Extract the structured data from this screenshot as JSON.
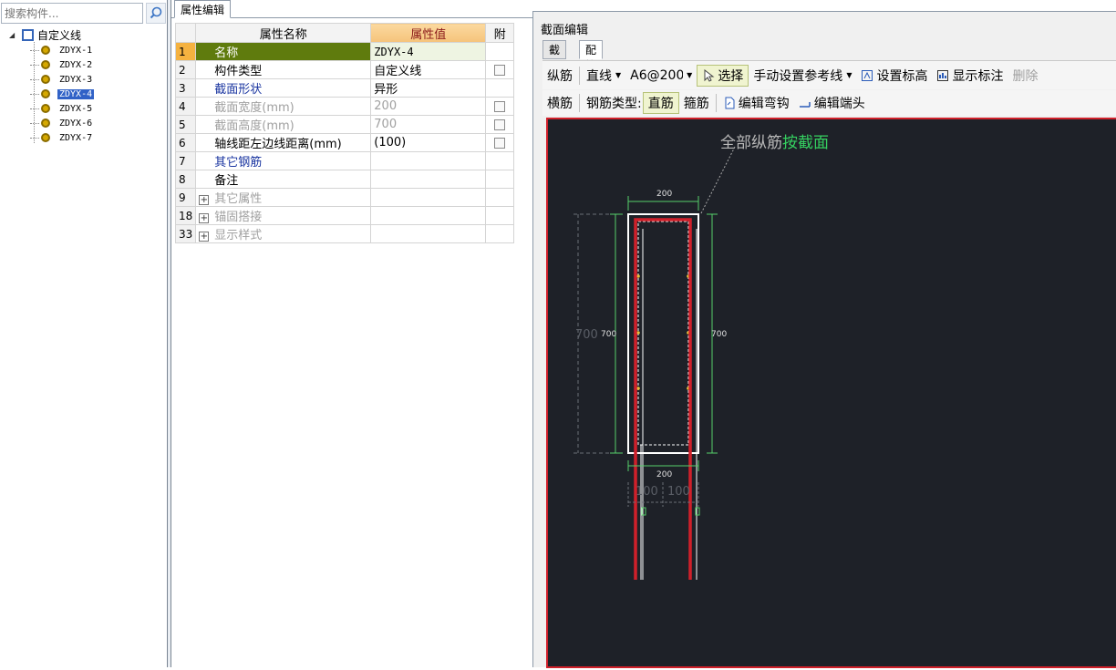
{
  "search": {
    "placeholder": "搜索构件..."
  },
  "tree": {
    "root_label": "自定义线",
    "items": [
      {
        "label": "ZDYX-1",
        "selected": false
      },
      {
        "label": "ZDYX-2",
        "selected": false
      },
      {
        "label": "ZDYX-3",
        "selected": false
      },
      {
        "label": "ZDYX-4",
        "selected": true
      },
      {
        "label": "ZDYX-5",
        "selected": false
      },
      {
        "label": "ZDYX-6",
        "selected": false
      },
      {
        "label": "ZDYX-7",
        "selected": false
      }
    ]
  },
  "property_panel": {
    "tab": "属性编辑",
    "headers": {
      "name": "属性名称",
      "value": "属性值",
      "attach": "附"
    },
    "rows": [
      {
        "num": "1",
        "name": "名称",
        "value": "ZDYX-4"
      },
      {
        "num": "2",
        "name": "构件类型",
        "value": "自定义线"
      },
      {
        "num": "3",
        "name": "截面形状",
        "value": "异形"
      },
      {
        "num": "4",
        "name": "截面宽度(mm)",
        "value": "200"
      },
      {
        "num": "5",
        "name": "截面高度(mm)",
        "value": "700"
      },
      {
        "num": "6",
        "name": "轴线距左边线距离(mm)",
        "value": "(100)"
      },
      {
        "num": "7",
        "name": "其它钢筋",
        "value": ""
      },
      {
        "num": "8",
        "name": "备注",
        "value": ""
      },
      {
        "num": "9",
        "name": "其它属性",
        "value": ""
      },
      {
        "num": "18",
        "name": "锚固搭接",
        "value": ""
      },
      {
        "num": "33",
        "name": "显示样式",
        "value": ""
      }
    ]
  },
  "editor": {
    "title": "截面编辑",
    "tabs": [
      "截面",
      "配筋"
    ],
    "toolbar1": {
      "longitudinal": "纵筋",
      "line_mode": "直线",
      "spec": "A6@200",
      "select": "选择",
      "ref_line": "手动设置参考线",
      "set_elevation": "设置标高",
      "show_annotation": "显示标注",
      "delete": "删除"
    },
    "toolbar2": {
      "transverse": "横筋",
      "rebar_type_label": "钢筋类型:",
      "straight": "直筋",
      "stirrup": "箍筋",
      "edit_hook": "编辑弯钩",
      "edit_end": "编辑端头"
    },
    "canvas": {
      "label_a": "全部纵筋",
      "label_b": "按截面",
      "dim_top": "200",
      "dim_bottom": "200",
      "dim_left": "700",
      "dim_right": "700",
      "dim_far_left": "700",
      "dim_sub_a": "100",
      "dim_sub_b": "100"
    }
  }
}
